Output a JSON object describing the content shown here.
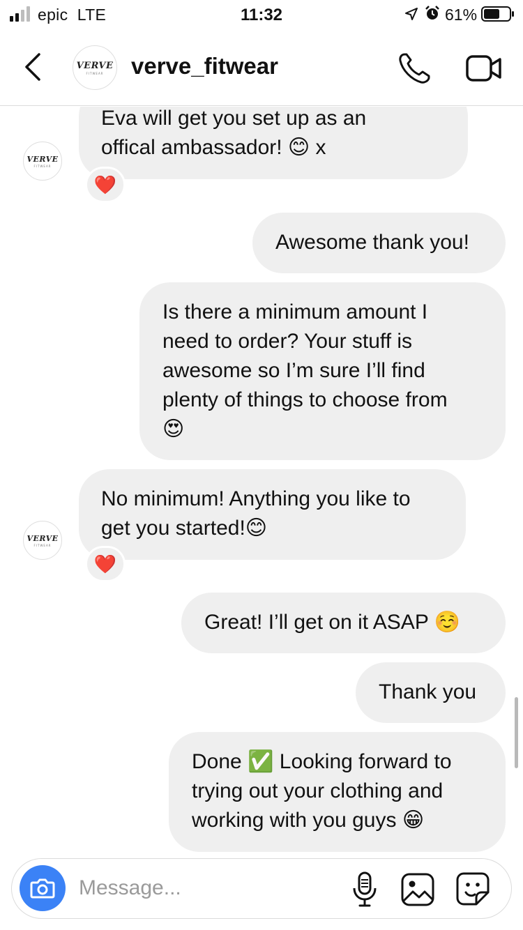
{
  "status_bar": {
    "carrier": "epic  LTE",
    "time": "11:32",
    "battery": "61%"
  },
  "header": {
    "username": "verve_fitwear",
    "avatar_logo": "VERVE",
    "avatar_logo_sub": "FITWEAR"
  },
  "messages": [
    {
      "from": "them",
      "text": "Eva will get you set up as an\noffical ambassador! ",
      "emoji": "😊",
      "suffix": " x",
      "reaction": "❤️"
    },
    {
      "from": "me",
      "text": "Awesome thank you!"
    },
    {
      "from": "me",
      "text": "Is there a minimum amount I\nneed to order? Your stuff is\nawesome so I’m sure I’ll find\nplenty of things to choose from\n",
      "emoji": "😍"
    },
    {
      "from": "them",
      "text": "No minimum! Anything you like to\nget you started!",
      "emoji": "😊",
      "reaction": "❤️"
    },
    {
      "from": "me",
      "text": "Great! I’ll get on it ASAP ",
      "emoji": "☺️"
    },
    {
      "from": "me",
      "text": "Thank you"
    },
    {
      "from": "me",
      "text": "Done ",
      "emoji": "✅",
      "text2": " Looking forward to\ntrying out your clothing and\nworking with you guys ",
      "emoji2": "😁"
    }
  ],
  "composer": {
    "placeholder": "Message..."
  },
  "icons": {
    "back": "chevron-left-icon",
    "call": "phone-icon",
    "video": "video-camera-icon",
    "camera": "camera-icon",
    "mic": "microphone-icon",
    "gallery": "image-icon",
    "sticker": "sticker-icon"
  },
  "colors": {
    "bubble": "#efefef",
    "camera_button": "#3b82f6",
    "heart": "#e0243c"
  }
}
